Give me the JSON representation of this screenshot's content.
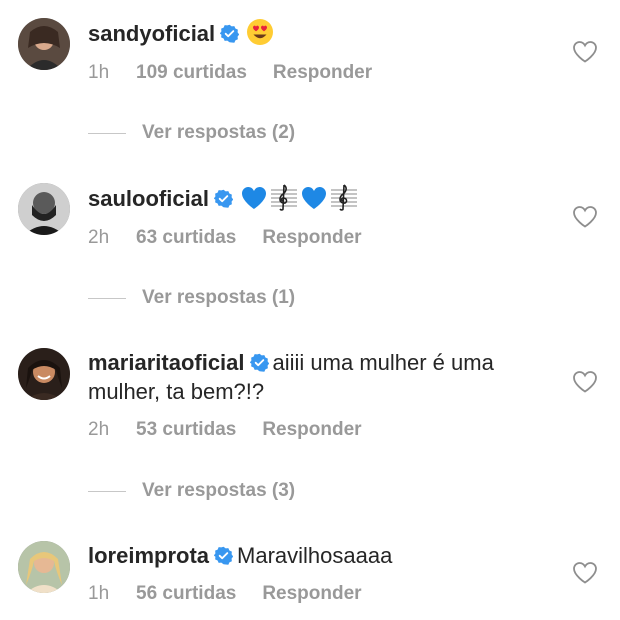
{
  "comments": [
    {
      "username": "sandyoficial",
      "message": "",
      "emoji": "heart-eyes-emoji",
      "time": "1h",
      "likes": "109 curtidas",
      "reply": "Responder",
      "view_replies": "Ver respostas (2)"
    },
    {
      "username": "saulooficial",
      "message": "",
      "emoji": "blue-heart-treble-clef-emoji-sequence",
      "time": "2h",
      "likes": "63 curtidas",
      "reply": "Responder",
      "view_replies": "Ver respostas (1)"
    },
    {
      "username": "mariaritaoficial",
      "message_line1": "aiiii uma mulher é uma",
      "message_line2": "mulher, ta bem?!?",
      "time": "2h",
      "likes": "53 curtidas",
      "reply": "Responder",
      "view_replies": "Ver respostas (3)"
    },
    {
      "username": "loreimprota",
      "message": "Maravilhosaaaa",
      "time": "1h",
      "likes": "56 curtidas",
      "reply": "Responder"
    }
  ],
  "colors": {
    "verified_blue": "#3897f0",
    "meta_gray": "#999999",
    "text": "#262626",
    "divider": "#c7c7c7",
    "heart_outline": "#8e8e8e"
  }
}
